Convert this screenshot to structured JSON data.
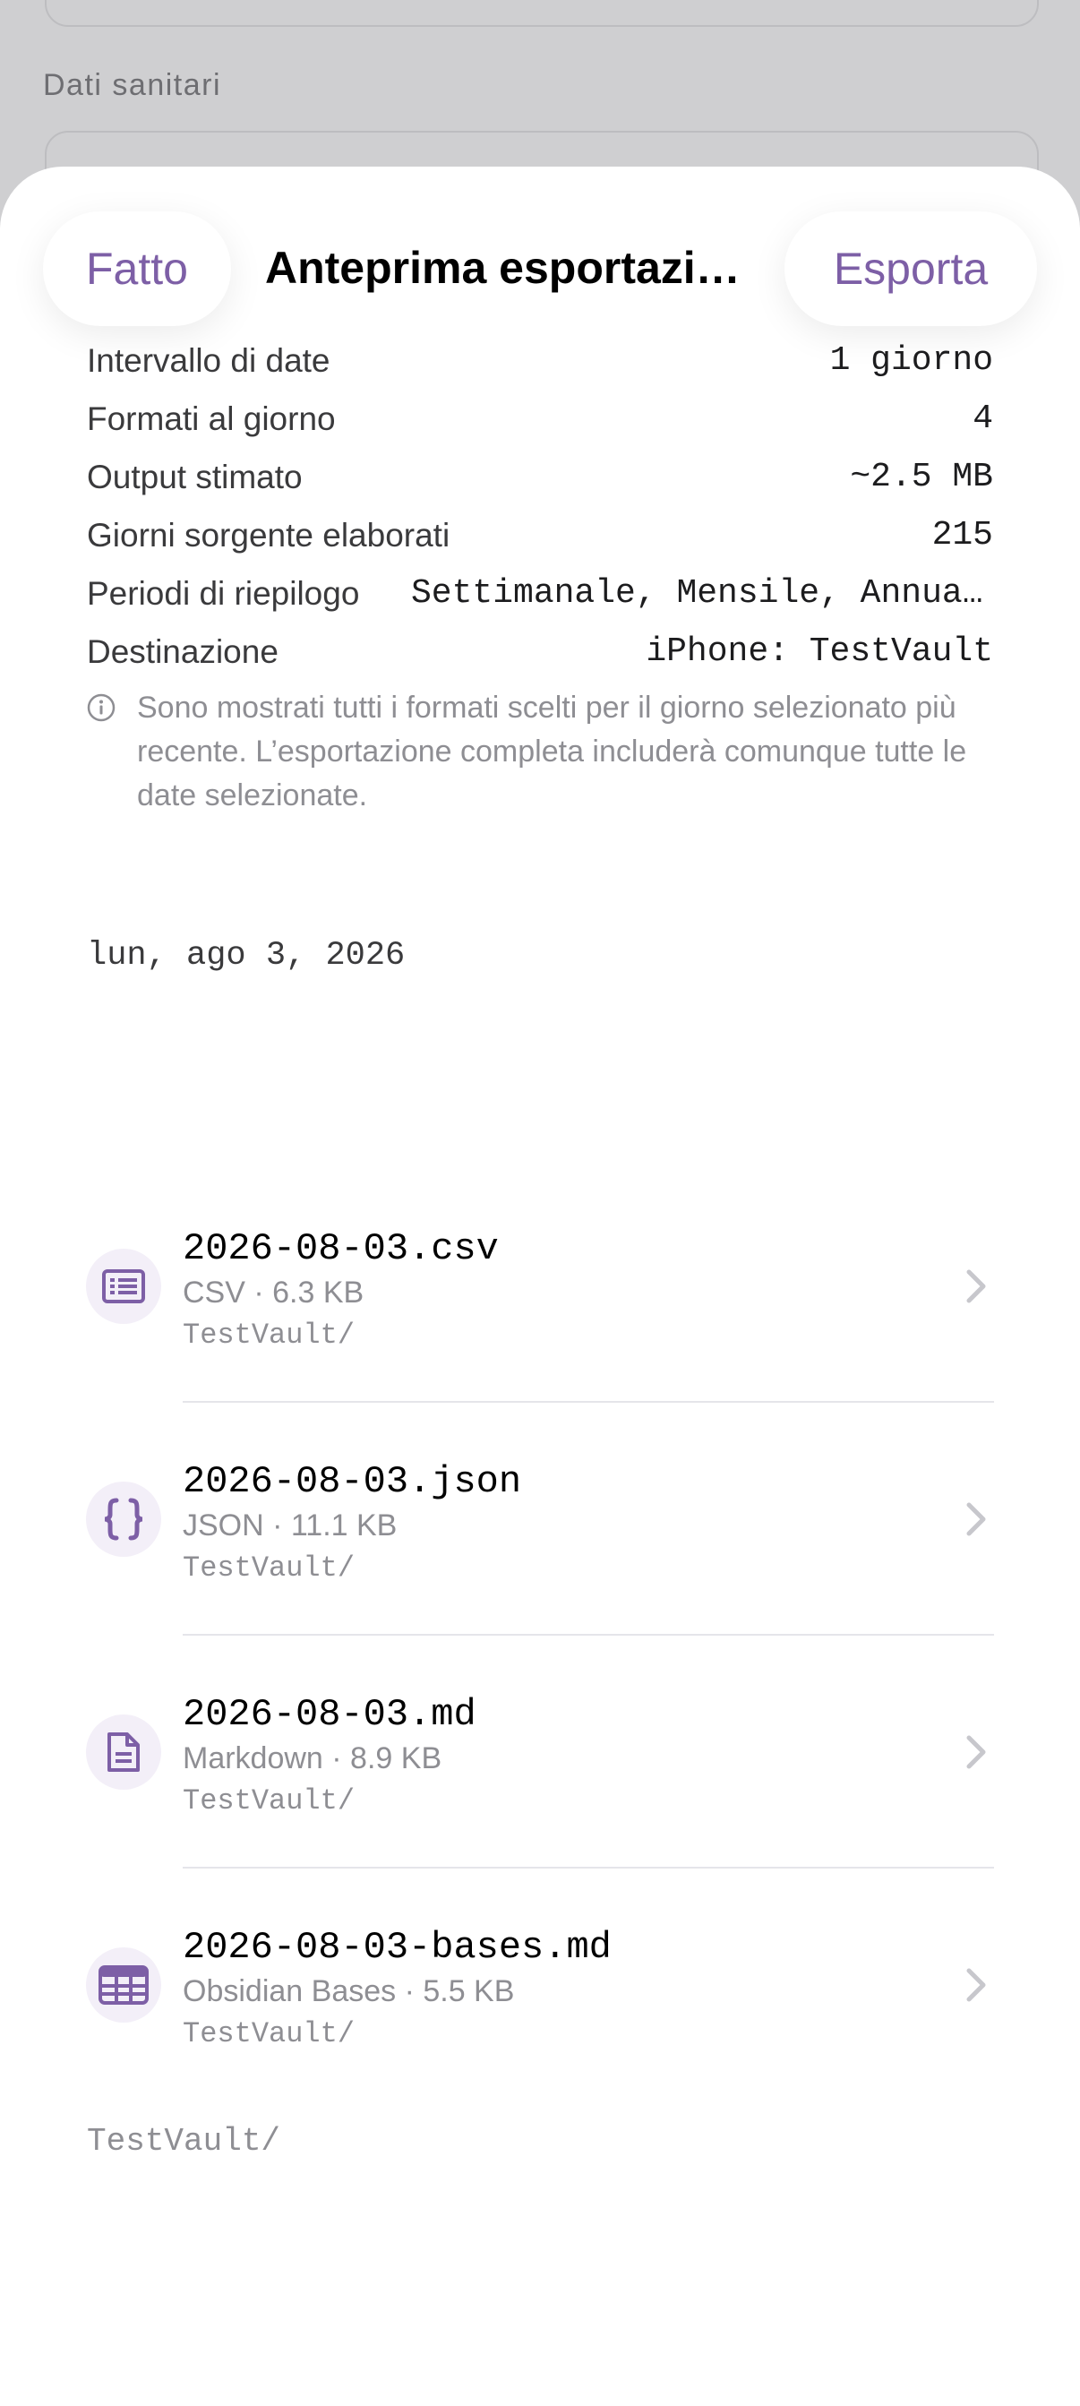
{
  "background": {
    "section_label": "Dati sanitari"
  },
  "sheet": {
    "done_label": "Fatto",
    "title": "Anteprima esportazione",
    "export_label": "Esporta"
  },
  "summary": [
    {
      "label": "Intervallo di date",
      "value": "1 giorno"
    },
    {
      "label": "Formati al giorno",
      "value": "4"
    },
    {
      "label": "Output stimato",
      "value": "~2.5 MB"
    },
    {
      "label": "Giorni sorgente elaborati",
      "value": "215"
    },
    {
      "label": "Periodi di riepilogo",
      "value": "Settimanale, Mensile, Annuale"
    },
    {
      "label": "Destinazione",
      "value": "iPhone: TestVault"
    }
  ],
  "note": "Sono mostrati tutti i formati scelti per il giorno selezionato più recente. L’esportazione completa includerà comunque tutte le date selezionate.",
  "date_header": "lun, ago 3, 2026",
  "files": [
    {
      "name": "2026-08-03.csv",
      "meta": "CSV · 6.3 KB",
      "path": "TestVault/",
      "icon": "list-icon"
    },
    {
      "name": "2026-08-03.json",
      "meta": "JSON · 11.1 KB",
      "path": "TestVault/",
      "icon": "braces-icon"
    },
    {
      "name": "2026-08-03.md",
      "meta": "Markdown · 8.9 KB",
      "path": "TestVault/",
      "icon": "document-icon"
    },
    {
      "name": "2026-08-03-bases.md",
      "meta": "Obsidian Bases · 5.5 KB",
      "path": "TestVault/",
      "icon": "table-icon"
    }
  ],
  "footer_path": "TestVault/",
  "colors": {
    "accent": "#7d5fa6",
    "icon_bg": "#f3eff8",
    "secondary_text": "#8e8e93"
  }
}
